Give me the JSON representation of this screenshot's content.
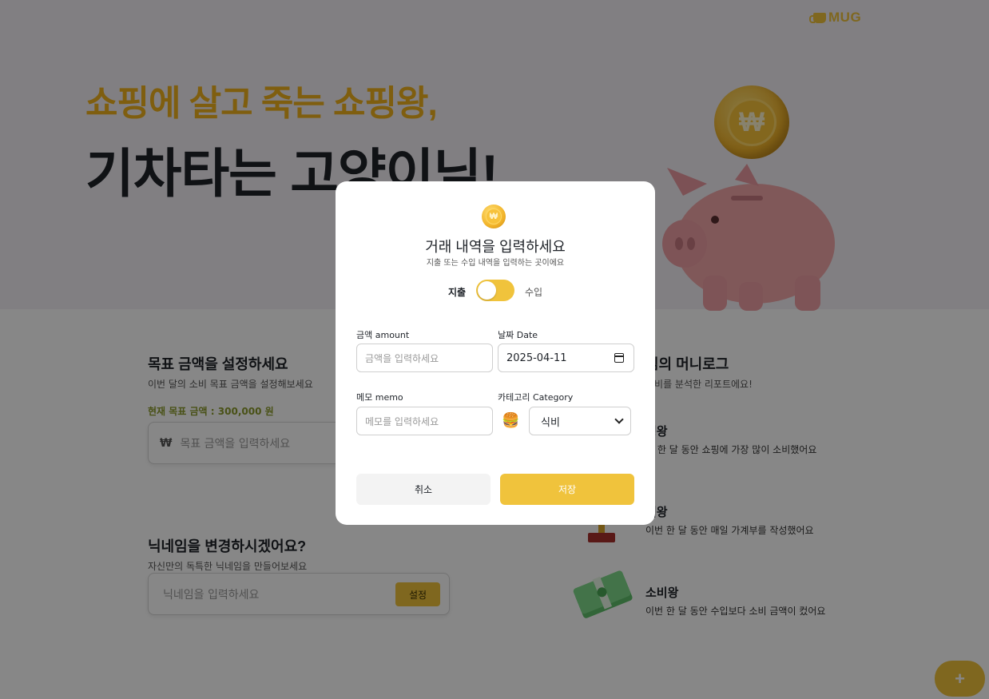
{
  "header": {
    "logo_text": "MUG"
  },
  "hero": {
    "line1": "쇼핑에 살고 죽는 쇼핑왕,",
    "line2": "기차타는 고양이님!",
    "coin_symbol": "₩"
  },
  "goal": {
    "title": "목표 금액을 설정하세요",
    "subtitle": "이번 달의 소비 목표 금액을 설정해보세요",
    "current_label": "현재 목표 금액 :",
    "current_value": "300,000 원",
    "currency": "₩",
    "input_placeholder": "목표 금액을 입력하세요"
  },
  "nickname": {
    "title": "닉네임을 변경하시겠어요?",
    "subtitle": "자신만의 독특한 닉네임을 만들어보세요",
    "input_placeholder": "닉네임을 입력하세요",
    "button_label": "설정"
  },
  "report": {
    "title": "님의 머니로그",
    "subtitle": "소비를 분석한 리포트에요!",
    "awards": [
      {
        "title": "핑왕",
        "desc": "번 한 달 동안 쇼핑에 가장 많이 소비했어요"
      },
      {
        "title": "석왕",
        "desc": "이번 한 달 동안 매일 가계부를 작성했어요"
      },
      {
        "title": "소비왕",
        "desc": "이번 한 달 동안 수입보다 소비 금액이 컸어요"
      }
    ]
  },
  "fab": {
    "label": "+"
  },
  "modal": {
    "coin_symbol": "₩",
    "title": "거래 내역을 입력하세요",
    "subtitle": "지출 또는 수입 내역을 입력하는 곳이에요",
    "toggle_left": "지출",
    "toggle_right": "수입",
    "amount_label": "금액 amount",
    "amount_placeholder": "금액을 입력하세요",
    "date_label": "날짜 Date",
    "date_value": "2025-04-11",
    "memo_label": "메모 memo",
    "memo_placeholder": "메모를 입력하세요",
    "category_label": "카테고리 Category",
    "category_icon": "🍔",
    "category_value": "식비",
    "cancel_label": "취소",
    "save_label": "저장"
  },
  "colors": {
    "accent": "#f0c33c",
    "hero_highlight": "#f0b21e",
    "overlay": "rgba(0,0,0,0.47)"
  }
}
